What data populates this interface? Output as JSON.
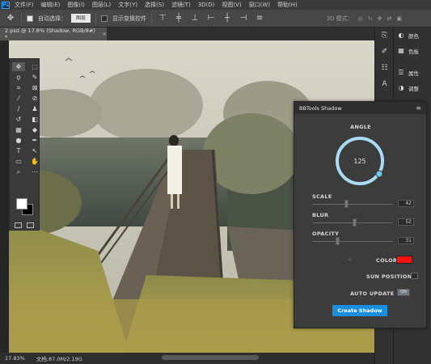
{
  "app": {
    "logo": "Ps"
  },
  "menubar": {
    "items": [
      "文件(F)",
      "编辑(E)",
      "图像(I)",
      "图层(L)",
      "文字(Y)",
      "选择(S)",
      "滤镜(T)",
      "3D(D)",
      "视图(V)",
      "窗口(W)",
      "帮助(H)"
    ]
  },
  "options": {
    "auto_select_label": "自动选择：",
    "auto_select_value": "图层",
    "show_transform_label": "显示变换控件",
    "mode_3d_label": "3D 模式："
  },
  "document": {
    "tab_label": "2.psd @ 17.8% (Shadow, RGB/8#) *",
    "close_glyph": "×"
  },
  "status": {
    "zoom": "17.83%",
    "doc_info": "文档:87.0M/2.19G"
  },
  "side_panels": {
    "items": [
      {
        "icon": "palette-icon",
        "label": "颜色"
      },
      {
        "icon": "swatches-icon",
        "label": "色板"
      },
      {
        "icon": "properties-icon",
        "label": "属性"
      },
      {
        "icon": "adjustments-icon",
        "label": "调整"
      },
      {
        "icon": "layers-icon",
        "label": "图层"
      },
      {
        "icon": "channels-icon",
        "label": "通道"
      },
      {
        "icon": "paths-icon",
        "label": "路径"
      }
    ]
  },
  "plugin": {
    "title": "BBTools Shadow",
    "angle_label": "ANGLE",
    "angle_value": "125",
    "scale_label": "SCALE",
    "scale_value": "42",
    "scale_fraction": 0.42,
    "blur_label": "BLUR",
    "blur_value": "52",
    "blur_fraction": 0.52,
    "opacity_label": "OPACITY",
    "opacity_value": "31",
    "opacity_fraction": 0.31,
    "color_label": "COLOR",
    "color_value": "#ff1111",
    "sun_position_label": "SUN POSITION",
    "auto_update_label": "AUTO UPDATE",
    "auto_update_state": "ON",
    "create_button": "Create Shadow"
  },
  "colors": {
    "accent": "#1a8fe0",
    "dial_ring": "#a9dcf2",
    "panel_bg": "#3c3c3c"
  }
}
